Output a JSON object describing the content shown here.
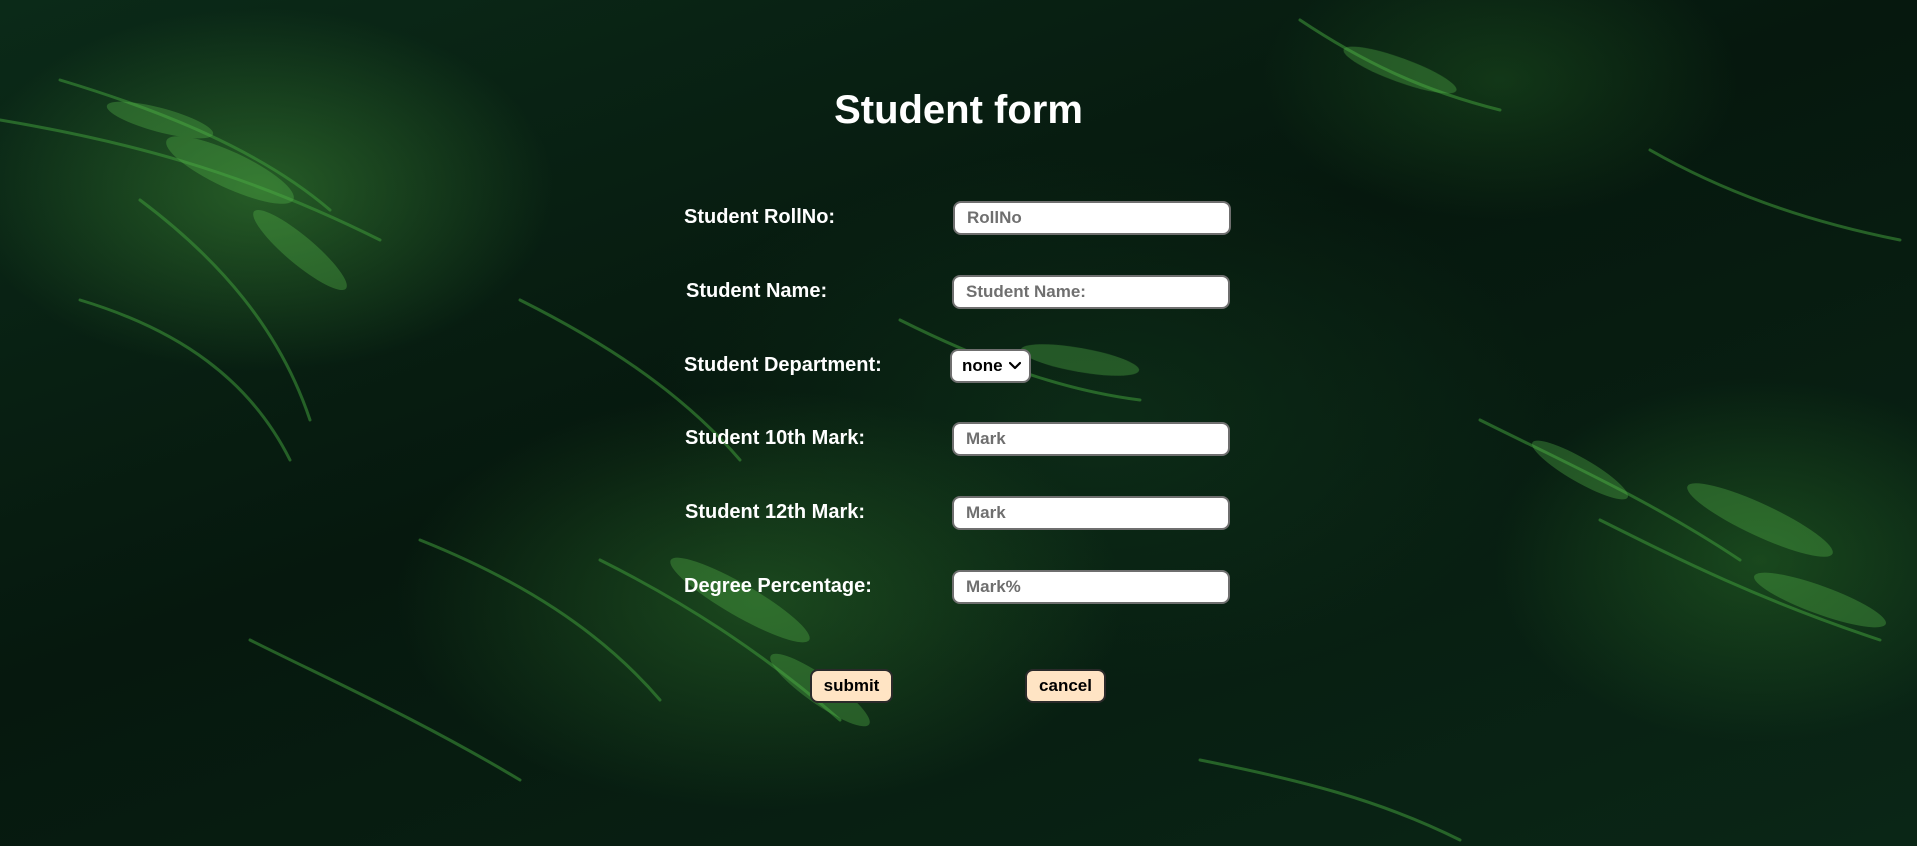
{
  "page": {
    "title": "Student form"
  },
  "form": {
    "rollno": {
      "label": "Student RollNo:",
      "placeholder": "RollNo",
      "value": ""
    },
    "name": {
      "label": "Student Name:",
      "placeholder": "Student Name:",
      "value": ""
    },
    "department": {
      "label": "Student Department:",
      "selected": "none",
      "options": [
        "none"
      ]
    },
    "mark10": {
      "label": "Student 10th Mark:",
      "placeholder": "Mark",
      "value": ""
    },
    "mark12": {
      "label": "Student 12th Mark:",
      "placeholder": "Mark",
      "value": ""
    },
    "degree": {
      "label": "Degree Percentage:",
      "placeholder": "Mark%",
      "value": ""
    }
  },
  "buttons": {
    "submit": "submit",
    "cancel": "cancel"
  },
  "colors": {
    "background": "#071d12",
    "button_bg": "#ffe4c4",
    "text": "#ffffff"
  },
  "icons": {
    "select_arrow": "chevron-down-icon"
  }
}
